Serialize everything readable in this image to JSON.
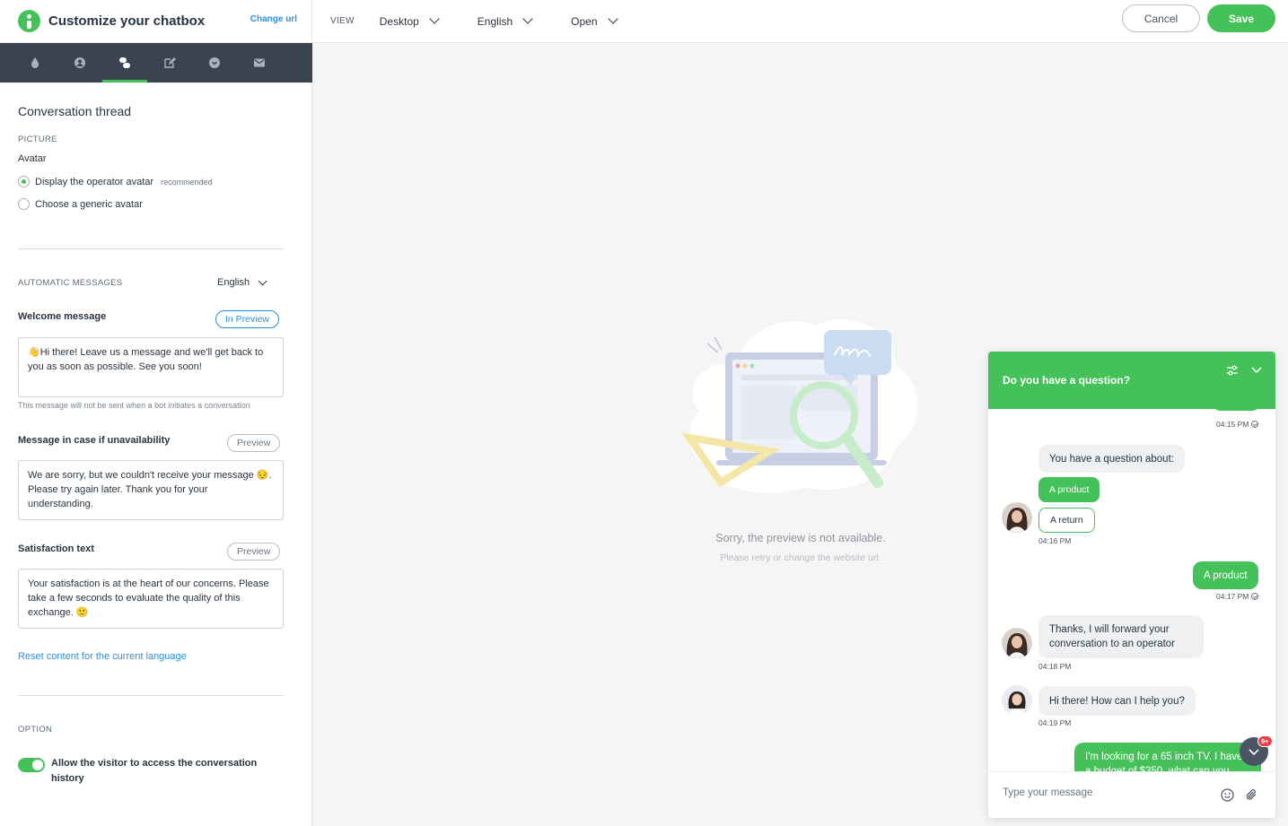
{
  "header": {
    "title": "Customize your chatbox",
    "change_url": "Change url",
    "view_label": "VIEW",
    "device": "Desktop",
    "language": "English",
    "state": "Open",
    "cancel": "Cancel",
    "save": "Save"
  },
  "icon_tabs": [
    {
      "icon": "drop-icon"
    },
    {
      "icon": "user-icon"
    },
    {
      "icon": "chat-bubbles-icon",
      "active": true
    },
    {
      "icon": "edit-icon"
    },
    {
      "icon": "chevron-circle-icon"
    },
    {
      "icon": "mail-icon"
    }
  ],
  "panel": {
    "title": "Conversation thread",
    "picture_caption": "PICTURE",
    "avatar_label": "Avatar",
    "avatar_options": [
      {
        "label": "Display the operator avatar",
        "note": "recommended",
        "selected": true
      },
      {
        "label": "Choose a generic avatar",
        "note": "",
        "selected": false
      }
    ],
    "auto_caption": "AUTOMATIC MESSAGES",
    "auto_language": "English",
    "welcome": {
      "label": "Welcome message",
      "button": "In Preview",
      "text": "👋Hi there! Leave us a message and we'll get back to you as soon as possible. See you soon!",
      "hint": "This message will not be sent when a bot initiates a conversation"
    },
    "unavailable": {
      "label": "Message in case if unavailability",
      "button": "Preview",
      "text": "We are sorry, but we couldn't receive your message 😔. Please try again later. Thank you for your understanding."
    },
    "satisfaction": {
      "label": "Satisfaction text",
      "button": "Preview",
      "text": "Your satisfaction is at the heart of our concerns. Please take a few seconds to evaluate the quality of this exchange. 🙂"
    },
    "reset_link": "Reset content for the current language",
    "option_caption": "OPTION",
    "history_toggle": {
      "label": "Allow the visitor to access the conversation history",
      "on": true
    }
  },
  "preview": {
    "unavailable_title": "Sorry, the preview is not available.",
    "unavailable_sub": "Please retry or change the website url."
  },
  "chat": {
    "title": "Do you have a question?",
    "messages": {
      "t1": "04:15 PM",
      "question": "You have a question about:",
      "choice1": "A product",
      "choice2": "A return",
      "t2": "04:16 PM",
      "out1": "A product",
      "t3": "04:17 PM",
      "forward": "Thanks, I will forward your conversation to an operator",
      "t4": "04:18 PM",
      "greeting": "Hi there! How can I help you?",
      "t5": "04:19 PM",
      "out2": "I'm looking for a 65 inch TV. I have a budget of $350, what can you"
    },
    "badge": "9+",
    "input_placeholder": "Type your message"
  },
  "colors": {
    "accent": "#45c15a",
    "link": "#2f8fd8",
    "tabbar": "#3a4350"
  }
}
